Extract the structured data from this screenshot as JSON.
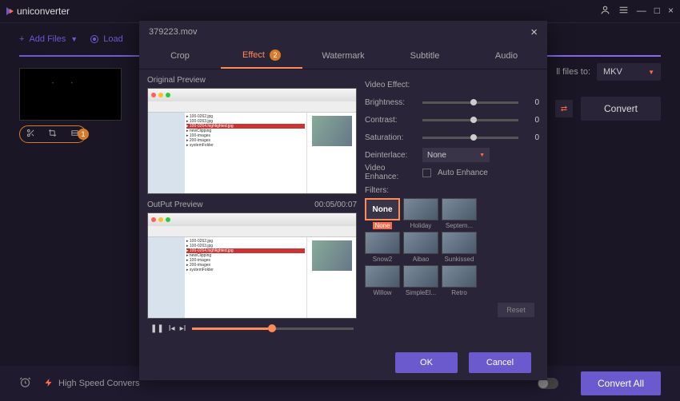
{
  "app": {
    "name": "uniconverter"
  },
  "window": {
    "user_icon": "user",
    "menu_icon": "menu",
    "min": "—",
    "max": "□",
    "close": "×"
  },
  "toolbar": {
    "add_files": "Add Files",
    "load": "Load"
  },
  "output": {
    "label_suffix": "ll files to:",
    "format": "MKV",
    "convert": "Convert"
  },
  "edit_tools": {
    "callout": "1"
  },
  "bottombar": {
    "high_speed": "High Speed Convers",
    "convert_all": "Convert All"
  },
  "modal": {
    "filename": "379223.mov",
    "tabs": [
      "Crop",
      "Effect",
      "Watermark",
      "Subtitle",
      "Audio"
    ],
    "active_tab": "Effect",
    "effect_badge": "2",
    "original_label": "Original Preview",
    "output_label": "OutPut Preview",
    "timecode": "00:05/00:07",
    "video_effect": "Video Effect:",
    "brightness": {
      "label": "Brightness:",
      "value": "0"
    },
    "contrast": {
      "label": "Contrast:",
      "value": "0"
    },
    "saturation": {
      "label": "Saturation:",
      "value": "0"
    },
    "deinterlace": {
      "label": "Deinterlace:",
      "value": "None"
    },
    "video_enhance": "Video Enhance:",
    "auto_enhance": "Auto Enhance",
    "filters_label": "Filters:",
    "filters": [
      "None",
      "Holiday",
      "Septem...",
      "Snow2",
      "Aibao",
      "Sunkissed",
      "Willow",
      "SimpleEl...",
      "Retro"
    ],
    "selected_filter": "None",
    "reset": "Reset",
    "ok": "OK",
    "cancel": "Cancel"
  }
}
